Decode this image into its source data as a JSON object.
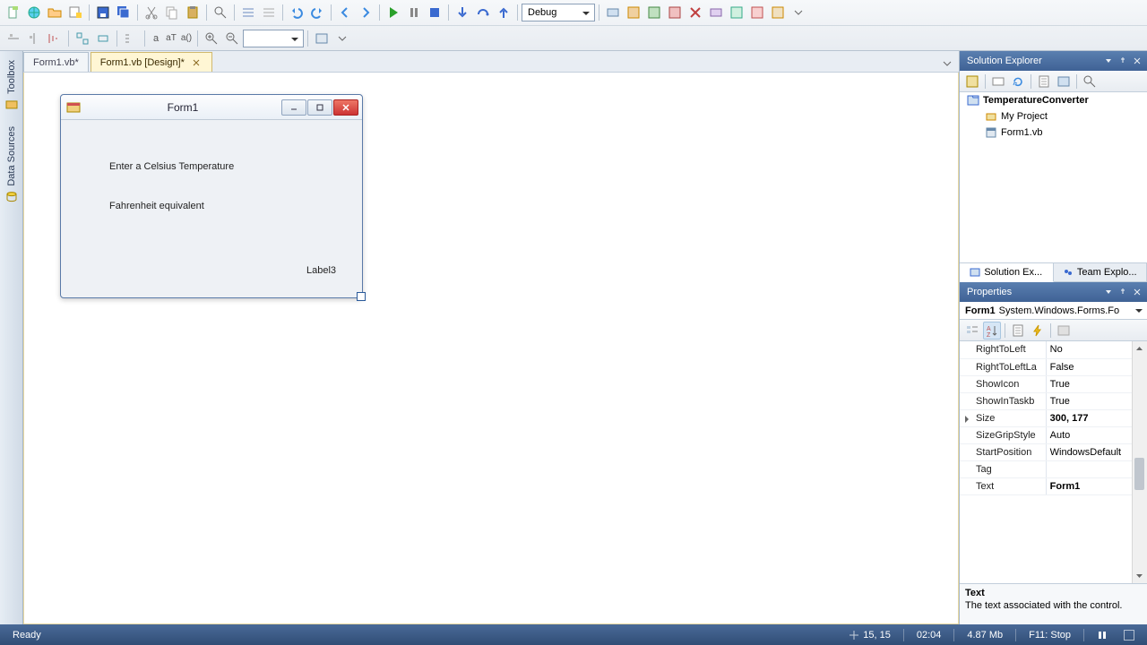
{
  "toolbar": {
    "config_dropdown": "Debug"
  },
  "tabs": [
    {
      "label": "Form1.vb*",
      "active": false
    },
    {
      "label": "Form1.vb [Design]*",
      "active": true
    }
  ],
  "rail": {
    "toolbox": "Toolbox",
    "datasources": "Data Sources"
  },
  "form": {
    "title": "Form1",
    "labels": {
      "celsius": "Enter a Celsius Temperature",
      "fahrenheit": "Fahrenheit equivalent",
      "label3": "Label3"
    }
  },
  "solution_explorer": {
    "title": "Solution Explorer",
    "project": "TemperatureConverter",
    "items": [
      {
        "label": "My Project"
      },
      {
        "label": "Form1.vb"
      }
    ],
    "tab_solution": "Solution Ex...",
    "tab_team": "Team Explo..."
  },
  "properties": {
    "title": "Properties",
    "object_name": "Form1",
    "object_type": "System.Windows.Forms.Fo",
    "rows": [
      {
        "name": "RightToLeft",
        "value": "No"
      },
      {
        "name": "RightToLeftLa",
        "value": "False"
      },
      {
        "name": "ShowIcon",
        "value": "True"
      },
      {
        "name": "ShowInTaskb",
        "value": "True"
      },
      {
        "name": "Size",
        "value": "300, 177",
        "bold": true,
        "expandable": true
      },
      {
        "name": "SizeGripStyle",
        "value": "Auto"
      },
      {
        "name": "StartPosition",
        "value": "WindowsDefault"
      },
      {
        "name": "Tag",
        "value": ""
      },
      {
        "name": "Text",
        "value": "Form1",
        "bold": true
      }
    ],
    "desc_title": "Text",
    "desc_body": "The text associated with the control."
  },
  "statusbar": {
    "ready": "Ready",
    "coords": "15, 15",
    "time": "02:04",
    "mem": "4.87 Mb",
    "key": "F11: Stop"
  }
}
